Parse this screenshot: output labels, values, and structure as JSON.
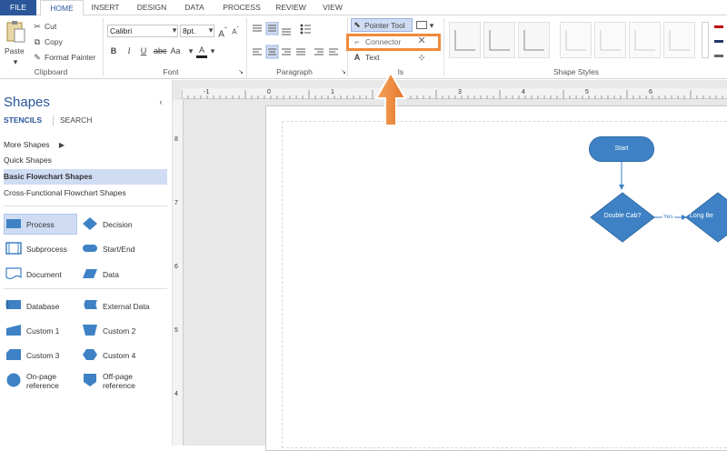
{
  "tabs": [
    "FILE",
    "HOME",
    "INSERT",
    "DESIGN",
    "DATA",
    "PROCESS",
    "REVIEW",
    "VIEW"
  ],
  "clipboard": {
    "paste": "Paste",
    "cut": "Cut",
    "copy": "Copy",
    "format_painter": "Format Painter",
    "label": "Clipboard"
  },
  "font": {
    "name": "Calibri",
    "size": "8pt.",
    "label": "Font"
  },
  "paragraph": {
    "label": "Paragraph"
  },
  "tools": {
    "pointer": "Pointer Tool",
    "connector": "Connector",
    "text": "Text",
    "label": "ls"
  },
  "shape_styles": {
    "label": "Shape Styles"
  },
  "sidebar": {
    "title": "Shapes",
    "stencils": "STENCILS",
    "search": "SEARCH",
    "items": [
      "More Shapes",
      "Quick Shapes",
      "Basic Flowchart Shapes",
      "Cross-Functional Flowchart Shapes"
    ],
    "shapes": [
      "Process",
      "Decision",
      "Subprocess",
      "Start/End",
      "Document",
      "Data",
      "Database",
      "External Data",
      "Custom 1",
      "Custom 2",
      "Custom 3",
      "Custom 4",
      "On-page reference",
      "Off-page reference"
    ]
  },
  "ruler": {
    "top": [
      "-1",
      "0",
      "1",
      "2",
      "3",
      "4",
      "5",
      "6"
    ],
    "left": [
      "8",
      "7",
      "6",
      "5",
      "4"
    ]
  },
  "diagram": {
    "start": "Start",
    "double_cab": "Double Cab?",
    "yes": "Yes",
    "long_bed": "Long Be"
  },
  "colors": {
    "accent": "#2b579a",
    "shape": "#3e82c5",
    "highlight": "#f08a3c"
  }
}
